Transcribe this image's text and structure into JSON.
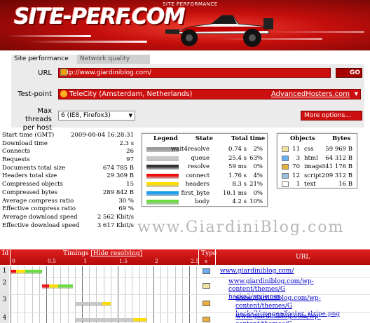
{
  "header": {
    "logo": "SITE-PERF.COM",
    "subtitle": "SITE PERFORMANCE"
  },
  "tabs": [
    {
      "label": "Site performance",
      "active": true
    },
    {
      "label": "Network quality",
      "active": false
    }
  ],
  "form": {
    "url_label": "URL",
    "url_value": "http://www.giardiniblog.com/",
    "go_label": "GO",
    "testpoint_label": "Test-point",
    "testpoint_value": "TeleCity (Amsterdam, Netherlands)",
    "testpoint_host": "AdvancedHosters.com",
    "threads_label_1": "Max threads",
    "threads_label_2": "per host",
    "threads_value": "6 (IE8, Firefox3)",
    "more_options": "More options..."
  },
  "stats": [
    {
      "label": "Start time (GMT)",
      "value": "2009-08-04 16:28:31"
    },
    {
      "label": "Download time",
      "value": "2.3 s"
    },
    {
      "label": "Connects",
      "value": "26"
    },
    {
      "label": "Requests",
      "value": "97"
    },
    {
      "label": "Documents total size",
      "value": "674 785 B"
    },
    {
      "label": "Headers total size",
      "value": "29 369 B"
    },
    {
      "label": "Compressed objects",
      "value": "15"
    },
    {
      "label": "Compressed bytes",
      "value": "289 842 B"
    },
    {
      "label": "Average compress ratio",
      "value": "30 %"
    },
    {
      "label": "Effective compress ratio",
      "value": "69 %"
    },
    {
      "label": "Average download speed",
      "value": "2 562 Kbit/s"
    },
    {
      "label": "Effective download speed",
      "value": "3 617 Kbit/s"
    }
  ],
  "legend": {
    "headers": {
      "legend": "Legend",
      "state": "State",
      "total": "Total time"
    },
    "rows": [
      {
        "state": "wait4resolve",
        "time": "0.74 s",
        "pct": "2%",
        "color": "#9a9a9a"
      },
      {
        "state": "queue",
        "time": "25.4 s",
        "pct": "63%",
        "color": "#c8c8c8"
      },
      {
        "state": "resolve",
        "time": "59 ms",
        "pct": "0%",
        "color": "#303030"
      },
      {
        "state": "connect",
        "time": "1.76 s",
        "pct": "4%",
        "color": "#ee1010"
      },
      {
        "state": "headers",
        "time": "8.3 s",
        "pct": "21%",
        "color": "#ffdd00"
      },
      {
        "state": "first_byte",
        "time": "10.1 ms",
        "pct": "0%",
        "color": "#1a9cf0"
      },
      {
        "state": "body",
        "time": "4.2 s",
        "pct": "10%",
        "color": "#6adc40"
      }
    ]
  },
  "objects": {
    "headers": {
      "objects": "Objects",
      "bytes": "Bytes"
    },
    "rows": [
      {
        "count": "11",
        "type": "css",
        "bytes": "59 969 B",
        "icon": "css-file-icon",
        "color": "#f0e2a0"
      },
      {
        "count": "3",
        "type": "html",
        "bytes": "64 312 B",
        "icon": "html-file-icon",
        "color": "#6aaef0"
      },
      {
        "count": "70",
        "type": "image",
        "bytes": "341 176 B",
        "icon": "image-file-icon",
        "color": "#e8b040"
      },
      {
        "count": "12",
        "type": "script",
        "bytes": "209 312 B",
        "icon": "script-file-icon",
        "color": "#9ac0e0"
      },
      {
        "count": "1",
        "type": "text",
        "bytes": "16 B",
        "icon": "text-file-icon",
        "color": "#ffffff"
      }
    ]
  },
  "watermark": "www.GiardiniBlog.com",
  "table": {
    "id_header": "Id",
    "timings_header": "Timings",
    "hide_link": "[Hide resolving]",
    "type_header": "Type",
    "url_header": "URL",
    "scale": [
      "0",
      "0.5",
      "1",
      "1.5",
      "2",
      "2.5",
      "s"
    ],
    "rows": [
      {
        "id": "1",
        "type_icon": "html-file-icon",
        "type_color": "#6aaef0",
        "url_lines": [
          "www.giardiniblog.com/"
        ],
        "segments": [
          {
            "state": "connect",
            "start": 0.0,
            "end": 0.08
          },
          {
            "state": "headers",
            "start": 0.08,
            "end": 0.21
          },
          {
            "state": "body",
            "start": 0.21,
            "end": 0.44
          }
        ]
      },
      {
        "id": "2",
        "type_icon": "css-file-icon",
        "type_color": "#f0e2a0",
        "url_lines": [
          "www.giardiniblog.com/wp-content/themes/G",
          "hacks2/style.css"
        ],
        "segments": [
          {
            "state": "connect",
            "start": 0.44,
            "end": 0.54
          },
          {
            "state": "headers",
            "start": 0.54,
            "end": 0.67
          },
          {
            "state": "body",
            "start": 0.67,
            "end": 0.87
          }
        ]
      },
      {
        "id": "3",
        "type_icon": "image-file-icon",
        "type_color": "#e8b040",
        "url_lines": [
          "www.giardiniblog.com/wp-content/themes/G",
          "hacks2/images/footer_stripe.png"
        ],
        "segments": [
          {
            "state": "queue",
            "start": 0.9,
            "end": 1.28
          },
          {
            "state": "headers",
            "start": 1.28,
            "end": 1.4
          }
        ]
      },
      {
        "id": "4",
        "type_icon": "image-file-icon",
        "type_color": "#e8b040",
        "url_lines": [
          "www.giardiniblog.com/wp-content/themes/G"
        ],
        "segments": [
          {
            "state": "queue",
            "start": 0.9,
            "end": 1.72
          },
          {
            "state": "headers",
            "start": 1.72,
            "end": 1.9
          }
        ]
      }
    ]
  }
}
